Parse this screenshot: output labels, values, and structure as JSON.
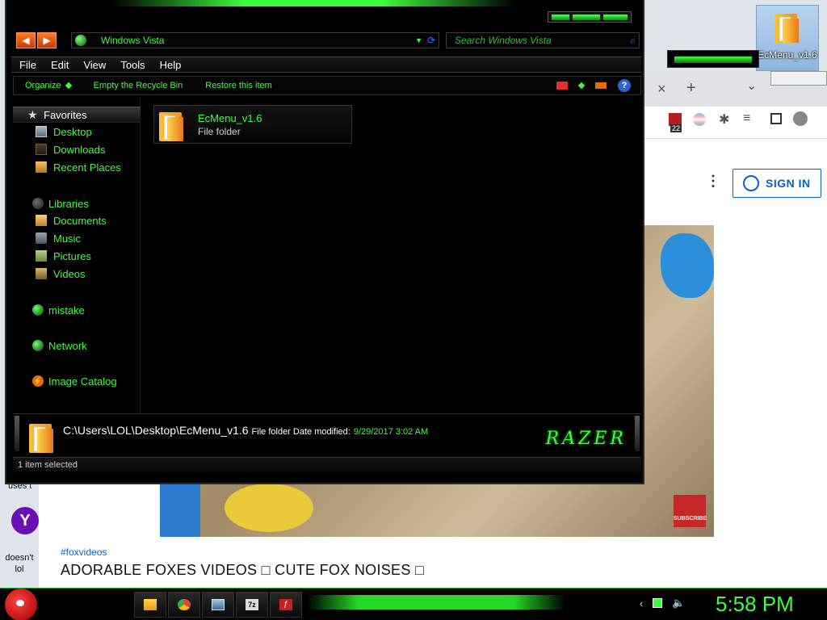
{
  "desktop": {
    "ecmenu_icon_label": "EcMenu_v1.6",
    "left_text": "uses t",
    "yahoo_label": "doesn't lol"
  },
  "browser": {
    "sign_in_label": "SIGN IN",
    "kebab_label": "⋮",
    "tab_close": "×",
    "tab_new": "+",
    "tab_list": "⌄",
    "badge_count": "22",
    "subscribe_label": "SUBSCRIBE",
    "hashtag": "#foxvideos",
    "video_title": "ADORABLE FOXES VIDEOS □ CUTE FOX NOISES □"
  },
  "explorer": {
    "nav_back": "◀",
    "nav_forward": "▶",
    "address": "Windows Vista",
    "search_placeholder": "Search Windows Vista",
    "menus": [
      "File",
      "Edit",
      "View",
      "Tools",
      "Help"
    ],
    "commands": {
      "organize": "Organize",
      "empty_bin": "Empty the Recycle Bin",
      "restore": "Restore this item",
      "help": "?"
    },
    "favorites": {
      "header": "Favorites",
      "items": [
        "Desktop",
        "Downloads",
        "Recent Places"
      ]
    },
    "libraries": {
      "header": "Libraries",
      "items": [
        "Documents",
        "Music",
        "Pictures",
        "Videos"
      ]
    },
    "other_nav": {
      "mistake": "mistake",
      "network": "Network",
      "image_catalog": "Image Catalog"
    },
    "file_item": {
      "name": "EcMenu_v1.6",
      "type": "File folder"
    },
    "details": {
      "path": "C:\\Users\\LOL\\Desktop\\EcMenu_v1.6",
      "meta": "File folder Date modified:",
      "date": "9/29/2017 3:02 AM",
      "brand": "RAZER"
    },
    "status": "1 item selected"
  },
  "taskbar": {
    "task_7z": "7z",
    "clock": "5:58 PM"
  },
  "icons": {
    "start": "angry-bird-icon",
    "files": "folder-icon",
    "chrome": "chrome-icon",
    "explorer": "window-icon",
    "zip": "7zip-icon",
    "flash": "flash-icon"
  },
  "colors": {
    "accent": "#3cff3c",
    "link": "#065fd4"
  }
}
